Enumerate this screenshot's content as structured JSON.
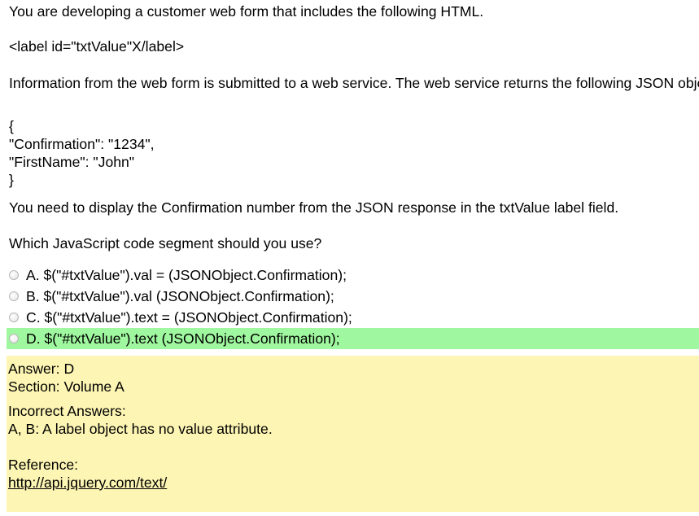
{
  "question": {
    "intro": "You are developing a customer web form that includes the following HTML.",
    "html_snippet": "<label id=\"txtValue\"X/label>",
    "service_text": "Information from the web form is submitted to a web service. The web service returns the following JSON object.",
    "json_lines": [
      "{",
      "\"Confirmation\": \"1234\",",
      "\"FirstName\": \"John\"",
      "}"
    ],
    "requirement": "You need to display the Confirmation number from the JSON response in the txtValue label field.",
    "prompt": "Which JavaScript code segment should you use?"
  },
  "options": [
    {
      "label": "A. $(\"#txtValue\").val = (JSONObject.Confirmation);",
      "correct": false
    },
    {
      "label": "B. $(\"#txtValue\").val (JSONObject.Confirmation);",
      "correct": false
    },
    {
      "label": "C. $(\"#txtValue\").text = (JSONObject.Confirmation);",
      "correct": false
    },
    {
      "label": "D. $(\"#txtValue\").text (JSONObject.Confirmation);",
      "correct": true
    }
  ],
  "answer": {
    "answer_line": "Answer: D",
    "section_line": "Section: Volume A",
    "incorrect_heading": "Incorrect Answers:",
    "incorrect_detail": "A, B: A label object has no value attribute.",
    "reference_heading": "Reference:",
    "reference_link": "http://api.jquery.com/text/"
  },
  "colors": {
    "correct_highlight": "#9ff89f",
    "answer_panel_bg": "#fdf5b3"
  }
}
